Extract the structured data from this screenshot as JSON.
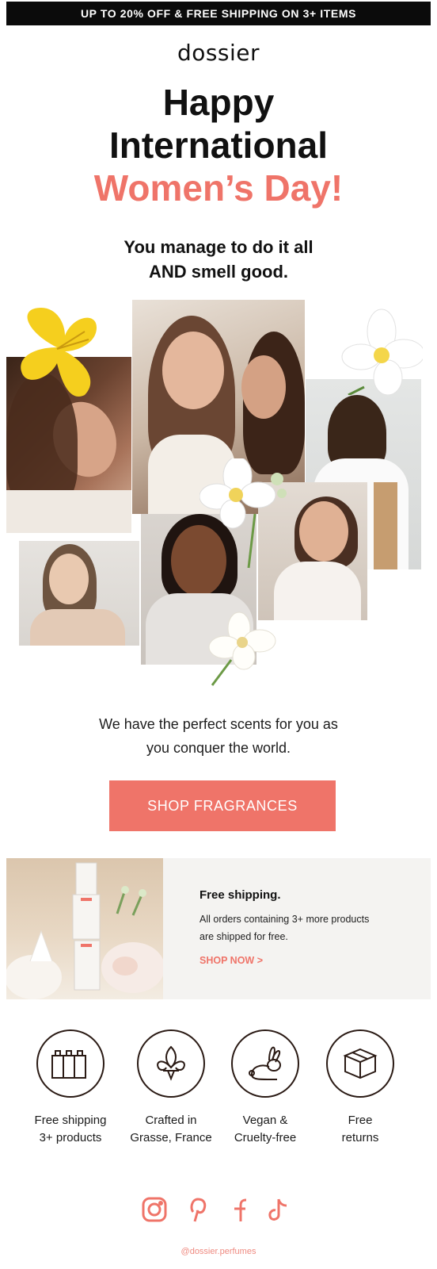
{
  "banner": {
    "text": "UP TO 20% OFF & FREE SHIPPING ON 3+ ITEMS"
  },
  "brand": {
    "logo": "dossier"
  },
  "hero": {
    "line1": "Happy",
    "line2": "International",
    "line3": "Women’s Day!",
    "subhead_line1": "You manage to do it all",
    "subhead_line2": "AND smell good."
  },
  "body": {
    "line1": "We have the perfect scents for you as",
    "line2": "you conquer the world."
  },
  "cta": {
    "label": "SHOP FRAGRANCES"
  },
  "promo": {
    "title": "Free shipping.",
    "desc_line1": "All orders containing 3+ more products",
    "desc_line2": "are shipped for free.",
    "link": "SHOP NOW >"
  },
  "features": [
    {
      "icon": "bottles-icon",
      "label": "Free shipping\n3+ products"
    },
    {
      "icon": "fleur-de-lis-icon",
      "label": "Crafted in\nGrasse, France"
    },
    {
      "icon": "rabbit-icon",
      "label": "Vegan &\nCruelty-free"
    },
    {
      "icon": "box-icon",
      "label": "Free\nreturns"
    }
  ],
  "social": [
    {
      "icon": "instagram-icon"
    },
    {
      "icon": "pinterest-icon"
    },
    {
      "icon": "facebook-icon"
    },
    {
      "icon": "tiktok-icon"
    }
  ],
  "footer": {
    "handle": "@dossier.perfumes"
  },
  "colors": {
    "accent": "#ef7469",
    "banner_bg": "#0b0b0b",
    "promo_bg": "#f4f3f1",
    "icon_stroke": "#2a1a14"
  }
}
